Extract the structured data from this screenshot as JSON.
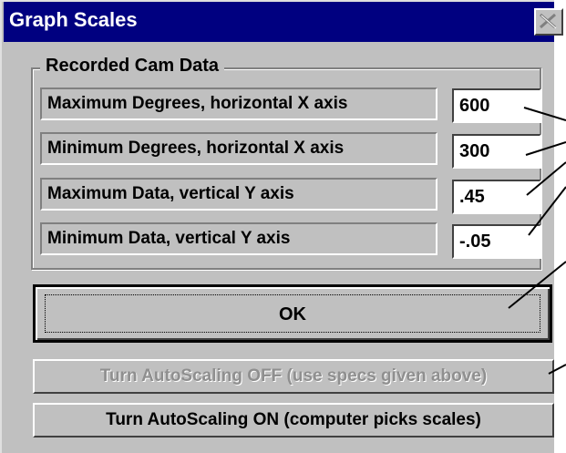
{
  "window": {
    "title": "Graph Scales"
  },
  "group": {
    "label": "Recorded Cam Data",
    "fields": [
      {
        "label": "Maximum Degrees, horizontal X axis",
        "value": "600"
      },
      {
        "label": "Minimum Degrees, horizontal X axis",
        "value": "300"
      },
      {
        "label": "Maximum Data, vertical Y axis",
        "value": ".45"
      },
      {
        "label": "Minimum Data, vertical Y axis",
        "value": "-.05"
      }
    ]
  },
  "buttons": {
    "ok": "OK",
    "autoscale_off": "Turn AutoScaling OFF (use specs given above)",
    "autoscale_on": "Turn AutoScaling ON (computer picks scales)"
  },
  "colors": {
    "titlebar": "#000080",
    "face": "#c0c0c0",
    "disabled_text": "#8f8f8f"
  }
}
